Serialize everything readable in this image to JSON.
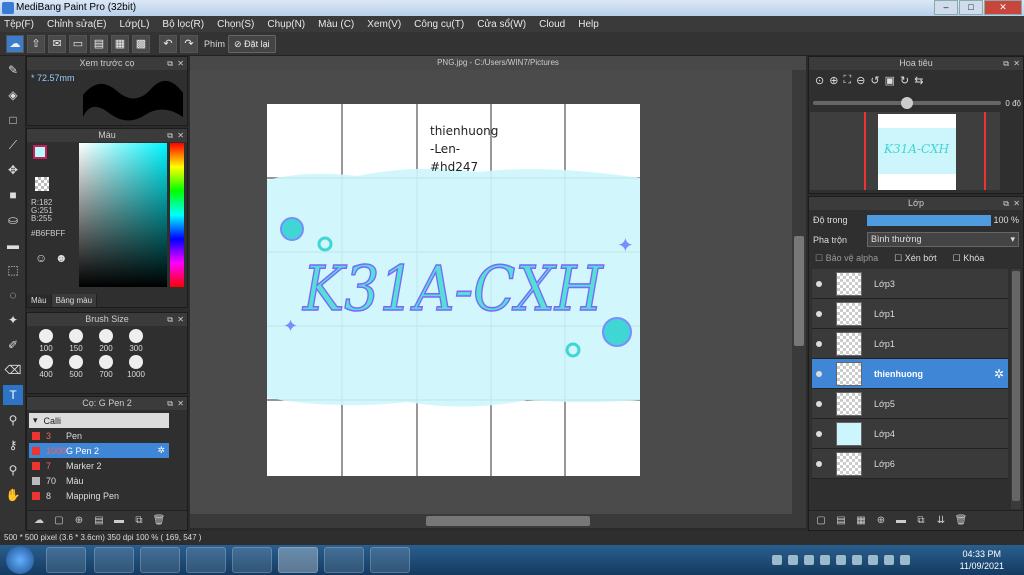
{
  "window": {
    "title": "MediBang Paint Pro (32bit)"
  },
  "menu": [
    "Tệp(F)",
    "Chỉnh sửa(E)",
    "Lớp(L)",
    "Bộ lọc(R)",
    "Chọn(S)",
    "Chụp(N)",
    "Màu (C)",
    "Xem(V)",
    "Công cụ(T)",
    "Cửa sổ(W)",
    "Cloud",
    "Help"
  ],
  "toolbar": {
    "shortcut_label": "Phím",
    "reset_label": "Đặt lại"
  },
  "brush_preview": {
    "title": "Xem trước cọ",
    "size": "* 72.57mm"
  },
  "color_panel": {
    "title": "Màu",
    "r": "R:182",
    "g": "G:251",
    "b": "B:255",
    "hex": "#B6FBFF",
    "tab_color": "Màu",
    "tab_palette": "Bảng màu",
    "main_color": "#b6fbff"
  },
  "brush_size": {
    "title": "Brush Size",
    "sizes": [
      "100",
      "150",
      "200",
      "300",
      "400",
      "500",
      "700",
      "1000"
    ]
  },
  "brush_list": {
    "title": "Cọ: G Pen 2",
    "group": "Calli",
    "items": [
      {
        "num": "3",
        "name": "Pen"
      },
      {
        "num": "1000",
        "name": "G Pen 2"
      },
      {
        "num": "7",
        "name": "Marker 2"
      },
      {
        "num": "70",
        "name": "Màu"
      },
      {
        "num": "8",
        "name": "Mapping Pen"
      }
    ]
  },
  "document": {
    "tab": "PNG.jpg - C:/Users/WIN7/Pictures"
  },
  "canvas": {
    "note_lines": [
      "thienhuong",
      "-Len-",
      "#hd247"
    ],
    "art_text": "K31A-CXH"
  },
  "navigator": {
    "title": "Hoa tiêu",
    "angle": "0 độ"
  },
  "layers": {
    "title": "Lớp",
    "opacity_label": "Độ trong",
    "opacity_value": "100 %",
    "opacity_fraction": 1.0,
    "blend_label": "Pha trộn",
    "blend_value": "Bình thường",
    "protect_alpha": "Bảo vệ alpha",
    "clip": "Xén bớt",
    "lock": "Khóa",
    "items": [
      "Lớp3",
      "Lớp1",
      "Lớp1",
      "thienhuong",
      "Lớp5",
      "Lớp4",
      "Lớp6"
    ],
    "selected_index": 3
  },
  "status": {
    "text": "500 * 500 pixel  (3.6 * 3.6cm)  350 dpi  100 %  ( 169, 547 )"
  },
  "taskbar": {
    "time": "04:33 PM",
    "date": "11/09/2021"
  }
}
